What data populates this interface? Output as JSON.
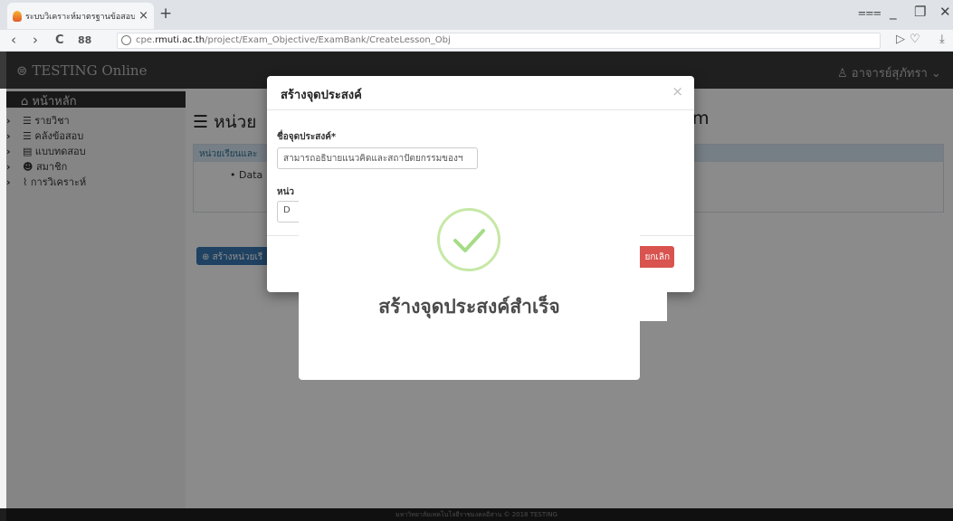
{
  "browser": {
    "tab_title": "ระบบวิเคราะห์มาตรฐานข้อสอบ",
    "tab_close": "×",
    "new_tab": "+",
    "url_host": "cpe.rmuti.ac.th",
    "url_path": "/project/Exam_Objective/ExamBank/CreateLesson_Obj",
    "url_prefix": "cpe.",
    "url_host_main": "rmuti.ac.th",
    "back": "‹",
    "forward": "›",
    "reload": "C",
    "grid": "88"
  },
  "app": {
    "brand": "TESTING Online",
    "user": "อาจารย์สุภัทรา"
  },
  "sidebar": {
    "home": "หน้าหลัก",
    "items": [
      {
        "label": "รายวิชา",
        "icon": "list-icon"
      },
      {
        "label": "คลังข้อสอบ",
        "icon": "database-icon"
      },
      {
        "label": "แบบทดสอบ",
        "icon": "book-icon"
      },
      {
        "label": "สมาชิก",
        "icon": "users-icon"
      },
      {
        "label": "การวิเคราะห์",
        "icon": "chart-icon"
      }
    ]
  },
  "main": {
    "title": "หน่วย",
    "title_tail": "m",
    "panel_header": "หน่วยเรียนและ",
    "panel_item": "Data",
    "create_button": "สร้างหน่วยเรี"
  },
  "modal": {
    "title": "สร้างจุดประสงค์",
    "close": "×",
    "field1_label": "ชื่อจุดประสงค์",
    "field1_required": "*",
    "field1_value": "สามารถอธิบายแนวคิดและสถาปัตยกรรมของฯ",
    "field2_label": "หน่ว",
    "field2_value": "D",
    "cancel": "ยกเลิก"
  },
  "alert": {
    "icon": "success-check-icon",
    "title": "สร้างจุดประสงค์สำเร็จ",
    "color": "#a5dc86"
  },
  "footer": {
    "text": "มหาวิทยาลัยเทคโนโลยีราชมงคลอีสาน © 2018 TESTING"
  }
}
